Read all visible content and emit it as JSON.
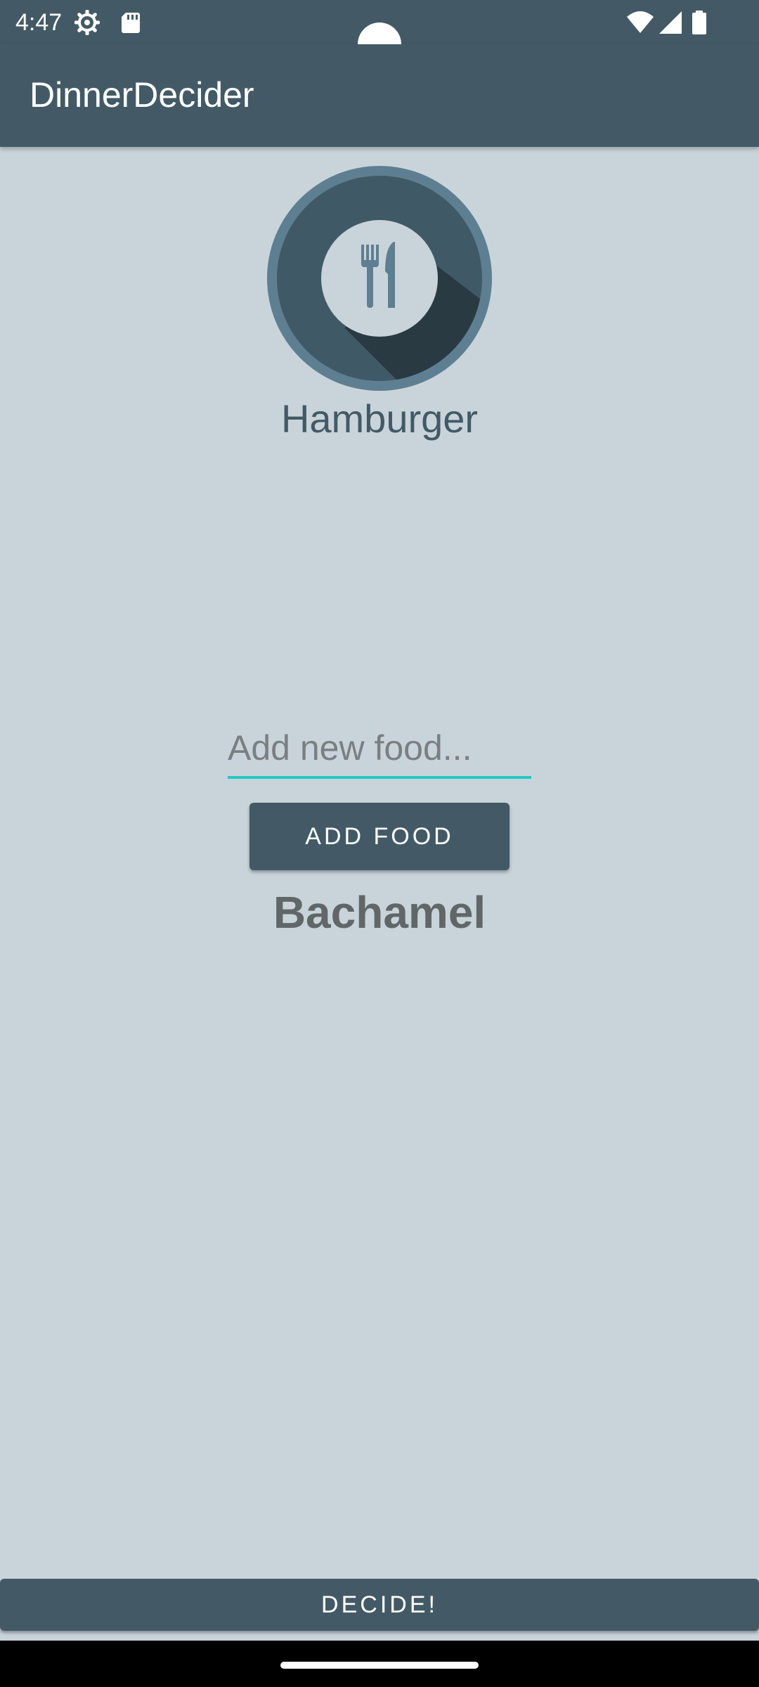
{
  "status_bar": {
    "time": "4:47",
    "icons": [
      "settings-gear-icon",
      "sd-card-icon",
      "wifi-icon",
      "signal-icon",
      "battery-icon"
    ]
  },
  "app_bar": {
    "title": "DinnerDecider"
  },
  "logo": {
    "icon": "fork-knife-icon"
  },
  "main": {
    "current_food": "Hamburger",
    "input_placeholder": "Add new food...",
    "add_button_label": "ADD FOOD",
    "last_added_food": "Bachamel",
    "decide_button_label": "DECIDE!"
  },
  "colors": {
    "primary": "#435a66",
    "background": "#c9d4da",
    "accent": "#22c9c4"
  }
}
